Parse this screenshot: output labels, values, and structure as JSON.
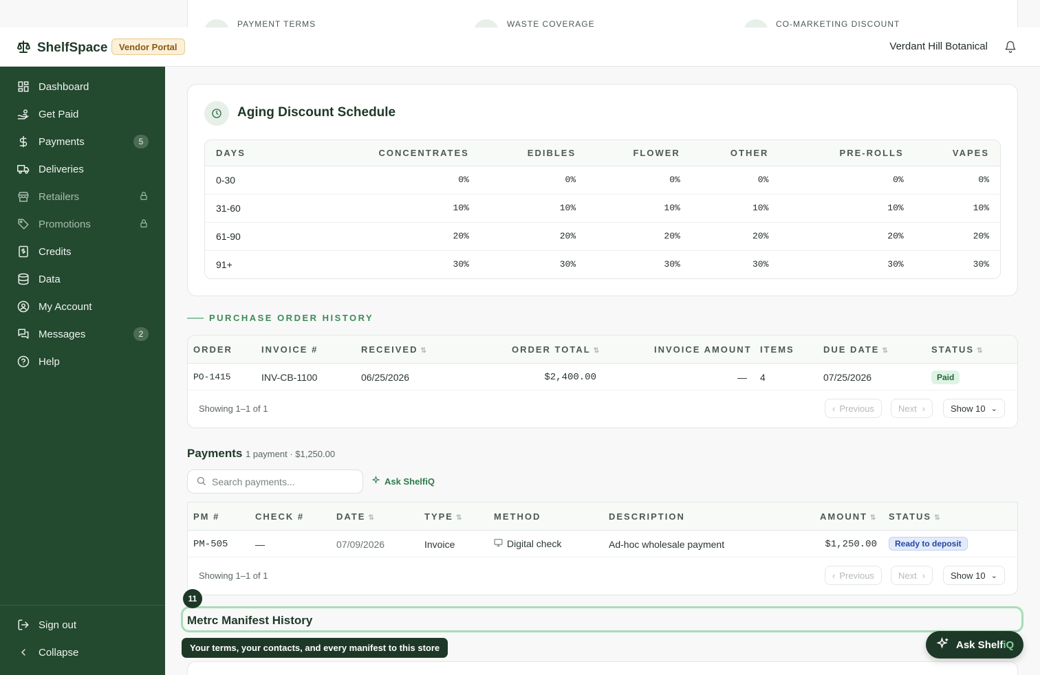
{
  "summary": {
    "items": [
      {
        "label": "PAYMENT TERMS"
      },
      {
        "label": "WASTE COVERAGE"
      },
      {
        "label": "CO-MARKETING DISCOUNT"
      }
    ]
  },
  "header": {
    "app_name": "ShelfSpace",
    "portal_badge": "Vendor Portal",
    "vendor_name": "Verdant Hill Botanical"
  },
  "sidebar": {
    "items": [
      {
        "label": "Dashboard",
        "icon": "dashboard-icon"
      },
      {
        "label": "Get Paid",
        "icon": "hand-coins-icon"
      },
      {
        "label": "Payments",
        "icon": "dollar-icon",
        "badge": "5"
      },
      {
        "label": "Deliveries",
        "icon": "truck-icon"
      },
      {
        "label": "Retailers",
        "icon": "store-icon",
        "locked": true
      },
      {
        "label": "Promotions",
        "icon": "tag-icon",
        "locked": true
      },
      {
        "label": "Credits",
        "icon": "receipt-icon"
      },
      {
        "label": "Data",
        "icon": "database-icon"
      },
      {
        "label": "My Account",
        "icon": "user-circle-icon"
      },
      {
        "label": "Messages",
        "icon": "messages-icon",
        "badge": "2"
      },
      {
        "label": "Help",
        "icon": "help-icon"
      }
    ],
    "sign_out": "Sign out",
    "collapse": "Collapse"
  },
  "aging": {
    "title": "Aging Discount Schedule",
    "columns": [
      "DAYS",
      "CONCENTRATES",
      "EDIBLES",
      "FLOWER",
      "OTHER",
      "PRE-ROLLS",
      "VAPES"
    ],
    "rows": [
      [
        "0-30",
        "0%",
        "0%",
        "0%",
        "0%",
        "0%",
        "0%"
      ],
      [
        "31-60",
        "10%",
        "10%",
        "10%",
        "10%",
        "10%",
        "10%"
      ],
      [
        "61-90",
        "20%",
        "20%",
        "20%",
        "20%",
        "20%",
        "20%"
      ],
      [
        "91+",
        "30%",
        "30%",
        "30%",
        "30%",
        "30%",
        "30%"
      ]
    ]
  },
  "po_history": {
    "section_label": "PURCHASE ORDER HISTORY",
    "columns": {
      "order": "ORDER",
      "invoice": "INVOICE #",
      "received": "RECEIVED",
      "order_total": "ORDER TOTAL",
      "invoice_amount": "INVOICE AMOUNT",
      "items": "ITEMS",
      "due_date": "DUE DATE",
      "status": "STATUS"
    },
    "rows": [
      {
        "order": "PO-1415",
        "invoice": "INV-CB-1100",
        "received": "06/25/2026",
        "order_total": "$2,400.00",
        "invoice_amount": "—",
        "items": "4",
        "due_date": "07/25/2026",
        "status": "Paid"
      }
    ],
    "showing": "Showing 1–1 of 1",
    "previous": "Previous",
    "next": "Next",
    "show": "Show 10"
  },
  "payments": {
    "title": "Payments",
    "subtitle": "1 payment · $1,250.00",
    "search_placeholder": "Search payments...",
    "ask_label": "Ask ShelfiQ",
    "columns": {
      "pm": "PM #",
      "check": "CHECK #",
      "date": "DATE",
      "type": "TYPE",
      "method": "METHOD",
      "description": "DESCRIPTION",
      "amount": "AMOUNT",
      "status": "STATUS"
    },
    "rows": [
      {
        "pm": "PM-505",
        "check": "—",
        "date": "07/09/2026",
        "type": "Invoice",
        "method": "Digital check",
        "description": "Ad-hoc wholesale payment",
        "amount": "$1,250.00",
        "status": "Ready to deposit"
      }
    ],
    "showing": "Showing 1–1 of 1",
    "previous": "Previous",
    "next": "Next",
    "show": "Show 10"
  },
  "metrc": {
    "title": "Metrc Manifest History",
    "step": "11",
    "tooltip": "Your terms, your contacts, and every manifest to this store"
  },
  "fab": {
    "label_main": "Ask Shelf",
    "label_accent": "iQ"
  },
  "colors": {
    "sidebar": "#23492f",
    "accent": "#3d8a5a",
    "paid_bg": "#dff3e4",
    "ready_bg": "#e3ebfb"
  }
}
